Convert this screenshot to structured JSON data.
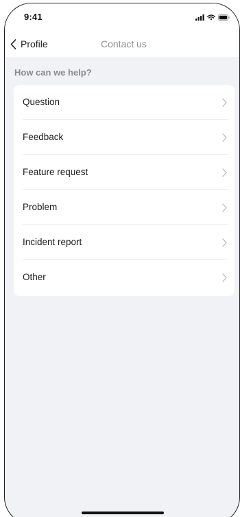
{
  "status_bar": {
    "time": "9:41",
    "icons": [
      "signal-icon",
      "wifi-icon",
      "battery-icon"
    ]
  },
  "nav": {
    "back_label": "Profile",
    "back_icon": "chevron-left-icon",
    "title": "Contact us"
  },
  "section": {
    "title": "How can we help?"
  },
  "items": [
    {
      "label": "Question",
      "icon": "chevron-right-icon"
    },
    {
      "label": "Feedback",
      "icon": "chevron-right-icon"
    },
    {
      "label": "Feature request",
      "icon": "chevron-right-icon"
    },
    {
      "label": "Problem",
      "icon": "chevron-right-icon"
    },
    {
      "label": "Incident report",
      "icon": "chevron-right-icon"
    },
    {
      "label": "Other",
      "icon": "chevron-right-icon"
    }
  ],
  "colors": {
    "background": "#f1f2f6",
    "card": "#ffffff",
    "text": "#1c1c1e",
    "muted": "#8e8e93",
    "divider": "#e4e4e8",
    "chevron": "#b8b8be"
  }
}
